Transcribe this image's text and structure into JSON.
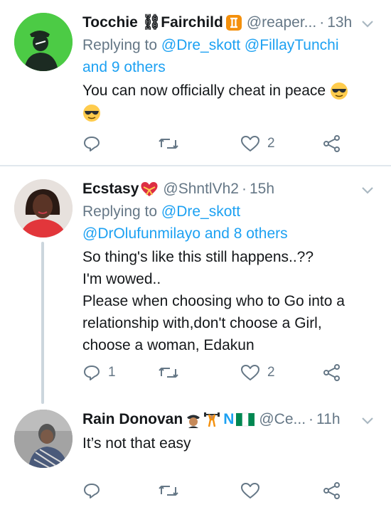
{
  "tweets": [
    {
      "name": "Tocchie ⛓Fairchild",
      "handle": "@reaper...",
      "time": "13h",
      "replying_prefix": "Replying to",
      "replying_mentions": "@Dre_skott @FillayTunchi",
      "replying_others": "and 9 others",
      "text_line1": "You can now officially cheat in peace",
      "replies": "",
      "retweets": "",
      "likes": "2"
    },
    {
      "name": "Ecstasy",
      "handle": "@ShntlVh2",
      "time": "15h",
      "replying_prefix": "Replying to",
      "replying_mentions": "@Dre_skott",
      "replying_others": "@DrOlufunmilayo and 8 others",
      "text_lines": [
        "So thing's like this still happens..??",
        "I'm wowed..",
        "Please when choosing who to Go into a",
        "relationship with,don't choose a Girl,",
        "choose a woman, Edakun"
      ],
      "replies": "1",
      "retweets": "",
      "likes": "2"
    },
    {
      "name": "Rain Donovan",
      "handle": "@Ce...",
      "time": "11h",
      "name_badge": "N",
      "text": "It’s not that easy",
      "replies": "",
      "retweets": "",
      "likes": ""
    }
  ],
  "icons": [
    "reply-icon",
    "retweet-icon",
    "like-icon",
    "share-icon",
    "caret-down-icon"
  ],
  "colors": {
    "link": "#1da1f2",
    "muted": "#657786",
    "text": "#14171a",
    "divider": "#e1e8ed",
    "badge_blue": "#1da1f2",
    "flag_green": "#008751"
  }
}
